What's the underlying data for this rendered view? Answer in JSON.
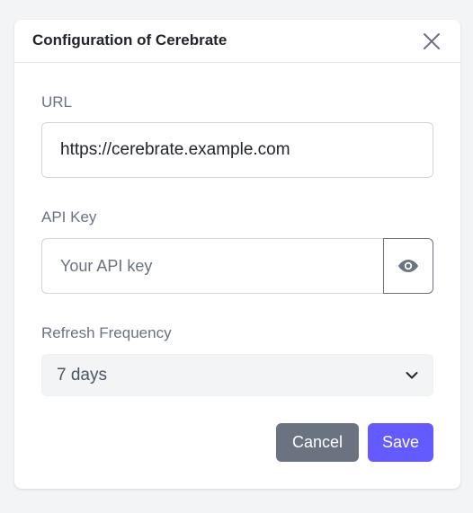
{
  "dialog": {
    "title": "Configuration of Cerebrate"
  },
  "url_field": {
    "label": "URL",
    "value": "https://cerebrate.example.com"
  },
  "api_key_field": {
    "label": "API Key",
    "placeholder": "Your API key",
    "value": "",
    "toggle_icon": "eye-icon"
  },
  "refresh_field": {
    "label": "Refresh Frequency",
    "selected": "7 days",
    "icon": "chevron-down-icon"
  },
  "actions": {
    "cancel_label": "Cancel",
    "save_label": "Save"
  },
  "colors": {
    "primary": "#635bff",
    "secondary": "#6b7280",
    "select_bg": "#f3f4f6"
  }
}
